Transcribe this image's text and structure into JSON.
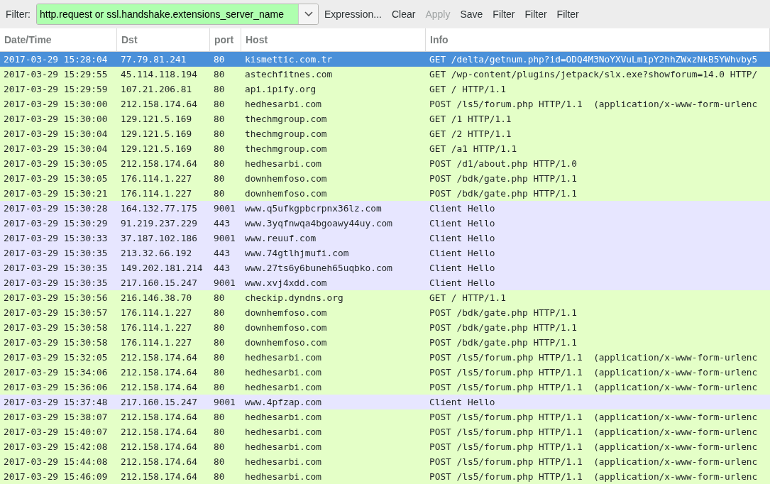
{
  "toolbar": {
    "label": "Filter:",
    "filter_value": "http.request or ssl.handshake.extensions_server_name",
    "buttons": [
      {
        "label": "Expression...",
        "disabled": false
      },
      {
        "label": "Clear",
        "disabled": false
      },
      {
        "label": "Apply",
        "disabled": true
      },
      {
        "label": "Save",
        "disabled": false
      },
      {
        "label": "Filter",
        "disabled": false
      },
      {
        "label": "Filter",
        "disabled": false
      },
      {
        "label": "Filter",
        "disabled": false
      }
    ]
  },
  "table": {
    "columns": [
      "Date/Time",
      "Dst",
      "port",
      "Host",
      "Info"
    ],
    "rows": [
      {
        "kind": "http",
        "selected": true,
        "cells": [
          "2017-03-29 15:28:04",
          "77.79.81.241",
          "80",
          "kismettic.com.tr",
          "GET /delta/getnum.php?id=ODQ4M3NoYXVuLm1pY2hhZWxzNkB5YWhvby5"
        ]
      },
      {
        "kind": "http",
        "selected": false,
        "cells": [
          "2017-03-29 15:29:55",
          "45.114.118.194",
          "80",
          "astechfitnes.com",
          "GET /wp-content/plugins/jetpack/slx.exe?showforum=14.0 HTTP/"
        ]
      },
      {
        "kind": "http",
        "selected": false,
        "cells": [
          "2017-03-29 15:29:59",
          "107.21.206.81",
          "80",
          "api.ipify.org",
          "GET / HTTP/1.1"
        ]
      },
      {
        "kind": "http",
        "selected": false,
        "cells": [
          "2017-03-29 15:30:00",
          "212.158.174.64",
          "80",
          "hedhesarbi.com",
          "POST /ls5/forum.php HTTP/1.1  (application/x-www-form-urlenc"
        ]
      },
      {
        "kind": "http",
        "selected": false,
        "cells": [
          "2017-03-29 15:30:00",
          "129.121.5.169",
          "80",
          "thechmgroup.com",
          "GET /1 HTTP/1.1"
        ]
      },
      {
        "kind": "http",
        "selected": false,
        "cells": [
          "2017-03-29 15:30:04",
          "129.121.5.169",
          "80",
          "thechmgroup.com",
          "GET /2 HTTP/1.1"
        ]
      },
      {
        "kind": "http",
        "selected": false,
        "cells": [
          "2017-03-29 15:30:04",
          "129.121.5.169",
          "80",
          "thechmgroup.com",
          "GET /a1 HTTP/1.1"
        ]
      },
      {
        "kind": "http",
        "selected": false,
        "cells": [
          "2017-03-29 15:30:05",
          "212.158.174.64",
          "80",
          "hedhesarbi.com",
          "POST /d1/about.php HTTP/1.0"
        ]
      },
      {
        "kind": "http",
        "selected": false,
        "cells": [
          "2017-03-29 15:30:05",
          "176.114.1.227",
          "80",
          "downhemfoso.com",
          "POST /bdk/gate.php HTTP/1.1"
        ]
      },
      {
        "kind": "http",
        "selected": false,
        "cells": [
          "2017-03-29 15:30:21",
          "176.114.1.227",
          "80",
          "downhemfoso.com",
          "POST /bdk/gate.php HTTP/1.1"
        ]
      },
      {
        "kind": "tls",
        "selected": false,
        "cells": [
          "2017-03-29 15:30:28",
          "164.132.77.175",
          "9001",
          "www.q5ufkgpbcrpnx36lz.com",
          "Client Hello"
        ]
      },
      {
        "kind": "tls",
        "selected": false,
        "cells": [
          "2017-03-29 15:30:29",
          "91.219.237.229",
          "443",
          "www.3yqfnwqa4bgoawy44uy.com",
          "Client Hello"
        ]
      },
      {
        "kind": "tls",
        "selected": false,
        "cells": [
          "2017-03-29 15:30:33",
          "37.187.102.186",
          "9001",
          "www.reuuf.com",
          "Client Hello"
        ]
      },
      {
        "kind": "tls",
        "selected": false,
        "cells": [
          "2017-03-29 15:30:35",
          "213.32.66.192",
          "443",
          "www.74gtlhjmufi.com",
          "Client Hello"
        ]
      },
      {
        "kind": "tls",
        "selected": false,
        "cells": [
          "2017-03-29 15:30:35",
          "149.202.181.214",
          "443",
          "www.27ts6y6buneh65uqbko.com",
          "Client Hello"
        ]
      },
      {
        "kind": "tls",
        "selected": false,
        "cells": [
          "2017-03-29 15:30:35",
          "217.160.15.247",
          "9001",
          "www.xvj4xdd.com",
          "Client Hello"
        ]
      },
      {
        "kind": "http",
        "selected": false,
        "cells": [
          "2017-03-29 15:30:56",
          "216.146.38.70",
          "80",
          "checkip.dyndns.org",
          "GET / HTTP/1.1"
        ]
      },
      {
        "kind": "http",
        "selected": false,
        "cells": [
          "2017-03-29 15:30:57",
          "176.114.1.227",
          "80",
          "downhemfoso.com",
          "POST /bdk/gate.php HTTP/1.1"
        ]
      },
      {
        "kind": "http",
        "selected": false,
        "cells": [
          "2017-03-29 15:30:58",
          "176.114.1.227",
          "80",
          "downhemfoso.com",
          "POST /bdk/gate.php HTTP/1.1"
        ]
      },
      {
        "kind": "http",
        "selected": false,
        "cells": [
          "2017-03-29 15:30:58",
          "176.114.1.227",
          "80",
          "downhemfoso.com",
          "POST /bdk/gate.php HTTP/1.1"
        ]
      },
      {
        "kind": "http",
        "selected": false,
        "cells": [
          "2017-03-29 15:32:05",
          "212.158.174.64",
          "80",
          "hedhesarbi.com",
          "POST /ls5/forum.php HTTP/1.1  (application/x-www-form-urlenc"
        ]
      },
      {
        "kind": "http",
        "selected": false,
        "cells": [
          "2017-03-29 15:34:06",
          "212.158.174.64",
          "80",
          "hedhesarbi.com",
          "POST /ls5/forum.php HTTP/1.1  (application/x-www-form-urlenc"
        ]
      },
      {
        "kind": "http",
        "selected": false,
        "cells": [
          "2017-03-29 15:36:06",
          "212.158.174.64",
          "80",
          "hedhesarbi.com",
          "POST /ls5/forum.php HTTP/1.1  (application/x-www-form-urlenc"
        ]
      },
      {
        "kind": "tls",
        "selected": false,
        "cells": [
          "2017-03-29 15:37:48",
          "217.160.15.247",
          "9001",
          "www.4pfzap.com",
          "Client Hello"
        ]
      },
      {
        "kind": "http",
        "selected": false,
        "cells": [
          "2017-03-29 15:38:07",
          "212.158.174.64",
          "80",
          "hedhesarbi.com",
          "POST /ls5/forum.php HTTP/1.1  (application/x-www-form-urlenc"
        ]
      },
      {
        "kind": "http",
        "selected": false,
        "cells": [
          "2017-03-29 15:40:07",
          "212.158.174.64",
          "80",
          "hedhesarbi.com",
          "POST /ls5/forum.php HTTP/1.1  (application/x-www-form-urlenc"
        ]
      },
      {
        "kind": "http",
        "selected": false,
        "cells": [
          "2017-03-29 15:42:08",
          "212.158.174.64",
          "80",
          "hedhesarbi.com",
          "POST /ls5/forum.php HTTP/1.1  (application/x-www-form-urlenc"
        ]
      },
      {
        "kind": "http",
        "selected": false,
        "cells": [
          "2017-03-29 15:44:08",
          "212.158.174.64",
          "80",
          "hedhesarbi.com",
          "POST /ls5/forum.php HTTP/1.1  (application/x-www-form-urlenc"
        ]
      },
      {
        "kind": "http",
        "selected": false,
        "cells": [
          "2017-03-29 15:46:09",
          "212.158.174.64",
          "80",
          "hedhesarbi.com",
          "POST /ls5/forum.php HTTP/1.1  (application/x-www-form-urlenc"
        ]
      }
    ]
  }
}
